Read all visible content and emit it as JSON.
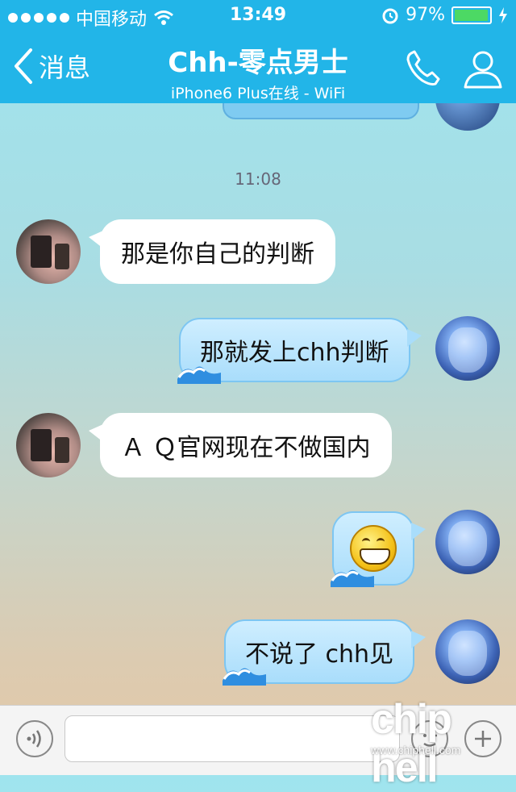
{
  "status_bar": {
    "carrier": "中国移动",
    "time": "13:49",
    "battery_percent": "97%",
    "battery_level": 0.97
  },
  "nav": {
    "back_label": "消息",
    "title": "Chh-零点男士",
    "subtitle": "iPhone6 Plus在线 - WiFi"
  },
  "chat": {
    "timestamp": "11:08",
    "messages": [
      {
        "from": "other",
        "text": "那是你自己的判断"
      },
      {
        "from": "me",
        "text": "那就发上chh判断"
      },
      {
        "from": "other",
        "text": "Ａ Ｑ官网现在不做国内"
      },
      {
        "from": "me",
        "type": "emoji",
        "emoji": "grin-emoji"
      },
      {
        "from": "me",
        "text": "不说了 chh见"
      }
    ]
  },
  "input_bar": {
    "text_value": ""
  },
  "watermark": {
    "logo": "chip hell",
    "url": "www.chiphell.com"
  },
  "colors": {
    "header": "#22b5e8",
    "bubble_in": "#ffffff",
    "bubble_out": "#a9ddfb"
  }
}
